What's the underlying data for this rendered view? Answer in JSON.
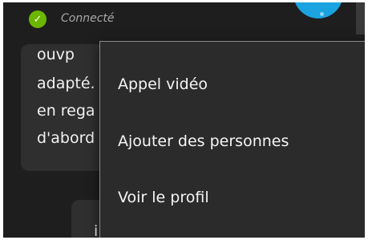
{
  "status": {
    "icon": "checkmark-icon",
    "label": "Connecté",
    "color": "#6bb700"
  },
  "avatar": {
    "color": "#1ba3e0"
  },
  "message": {
    "lines": [
      "ouvp",
      "adapté.",
      "en rega",
      "d'abord"
    ]
  },
  "message2": {
    "text": "i"
  },
  "context_menu": {
    "items": [
      {
        "label": "Appel vidéo"
      },
      {
        "label": "Ajouter des personnes"
      },
      {
        "label": "Voir le profil"
      }
    ]
  }
}
